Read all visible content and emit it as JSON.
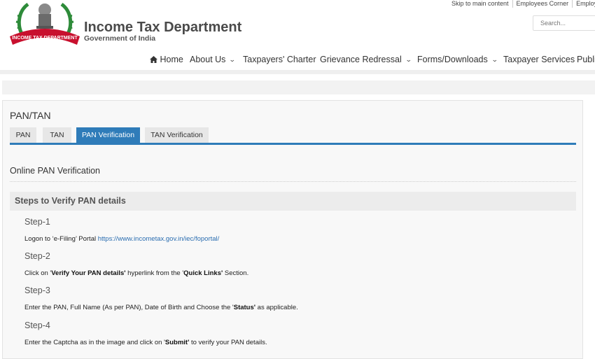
{
  "header": {
    "title": "Income Tax Department",
    "subtitle": "Government of India",
    "logo_ribbon": "INCOME TAX DEPARTMENT"
  },
  "top_links": [
    "Skip to main content",
    "Employees Corner",
    "Employee"
  ],
  "search": {
    "placeholder": "Search..."
  },
  "nav": {
    "home": "Home",
    "items": [
      "About Us",
      "Taxpayers' Charter",
      "Grievance Redressal",
      "Forms/Downloads",
      "Taxpayer Services",
      "Publi"
    ]
  },
  "panel": {
    "title": "PAN/TAN",
    "tabs": [
      "PAN",
      "TAN",
      "PAN Verification",
      "TAN Verification"
    ],
    "active_tab": "PAN Verification",
    "section_title": "Online PAN Verification",
    "steps_header": "Steps to Verify PAN details",
    "steps": [
      {
        "label": "Step-1",
        "pre": "Logon to ‘e-Filing’ Portal ",
        "link": "https://www.incometax.gov.in/iec/foportal/"
      },
      {
        "label": "Step-2",
        "t1": "Click on '",
        "b1": "Verify Your PAN details'",
        "t2": " hyperlink from the '",
        "b2": "Quick Links'",
        "t3": " Section."
      },
      {
        "label": "Step-3",
        "t1": "Enter the PAN, Full Name (As per PAN), Date of Birth and Choose the '",
        "b1": "Status'",
        "t2": " as applicable."
      },
      {
        "label": "Step-4",
        "t1": "Enter the Captcha as in the image and click on '",
        "b1": "Submit'",
        "t2": " to verify your PAN details."
      }
    ]
  },
  "colors": {
    "accent": "#2f7cb9",
    "link": "#2a6db0",
    "brand_red": "#c8102e",
    "emblem_green": "#2e8b3a"
  }
}
